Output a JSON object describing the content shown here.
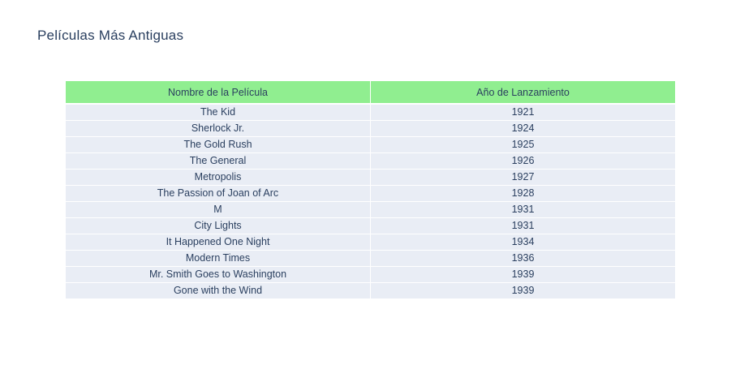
{
  "chart_data": {
    "type": "table",
    "title": "Películas Más Antiguas",
    "header_color": "#90ee90",
    "cell_color": "#e9edf5",
    "columns": [
      "Nombre de la Película",
      "Año de Lanzamiento"
    ],
    "rows": [
      [
        "The Kid",
        "1921"
      ],
      [
        "Sherlock Jr.",
        "1924"
      ],
      [
        "The Gold Rush",
        "1925"
      ],
      [
        "The General",
        "1926"
      ],
      [
        "Metropolis",
        "1927"
      ],
      [
        "The Passion of Joan of Arc",
        "1928"
      ],
      [
        "M",
        "1931"
      ],
      [
        "City Lights",
        "1931"
      ],
      [
        "It Happened One Night",
        "1934"
      ],
      [
        "Modern Times",
        "1936"
      ],
      [
        "Mr. Smith Goes to Washington",
        "1939"
      ],
      [
        "Gone with the Wind",
        "1939"
      ]
    ]
  }
}
